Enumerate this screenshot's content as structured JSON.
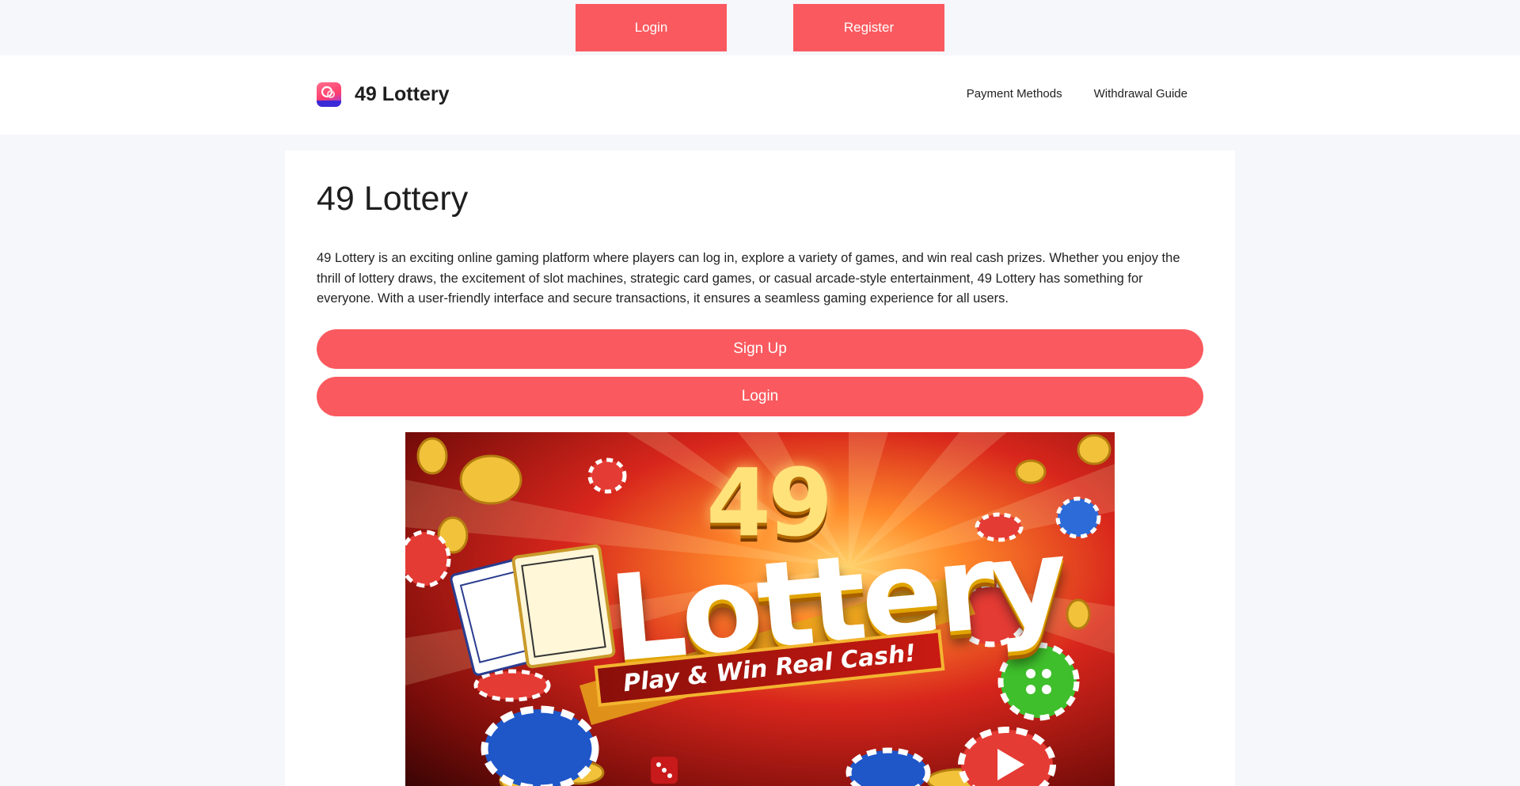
{
  "auth_bar": {
    "login_label": "Login",
    "register_label": "Register"
  },
  "header": {
    "site_title": "49 Lottery",
    "logo_icon": "49lottery-logo-icon",
    "nav": [
      {
        "label": "Payment Methods"
      },
      {
        "label": "Withdrawal Guide"
      }
    ]
  },
  "main": {
    "title": "49 Lottery",
    "intro": "49 Lottery is an exciting online gaming platform where players can log in, explore a variety of games, and win real cash prizes. Whether you enjoy the thrill of lottery draws, the excitement of slot machines, strategic card games, or casual arcade-style entertainment, 49 Lottery has something for everyone. With a user-friendly interface and secure transactions, it ensures a seamless gaming experience for all users.",
    "signup_label": "Sign Up",
    "login_label": "Login",
    "hero": {
      "number": "49",
      "word": "Lottery",
      "tagline": "Play & Win Real Cash!"
    }
  },
  "colors": {
    "accent": "#fa5a5f",
    "page_bg": "#f6f7fb",
    "card_bg": "#ffffff"
  }
}
